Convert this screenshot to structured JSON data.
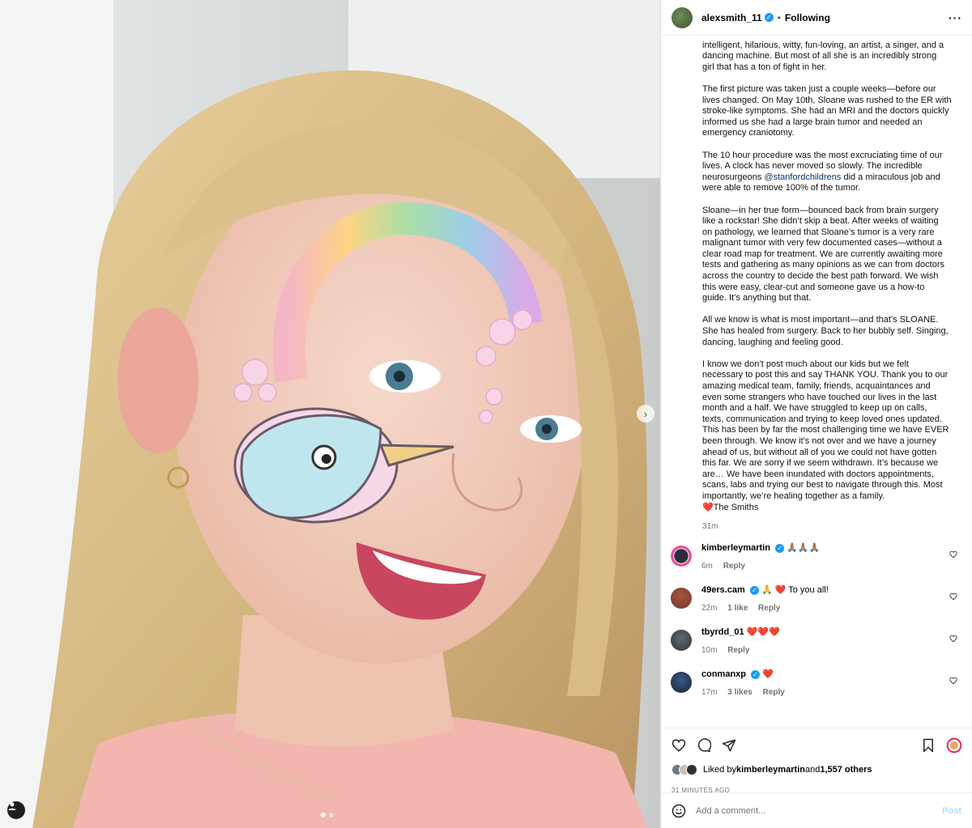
{
  "post": {
    "username": "alexsmith_11",
    "follow_status": "Following",
    "more_icon": "more-horizontal-icon"
  },
  "caption": {
    "p0": "intelligent, hilarious, witty, fun-loving, an artist, a singer, and a\ndancing machine. But most of all she is an incredibly strong\ngirl that has a ton of fight in her.",
    "p1": "The first picture was taken just a couple weeks—before our\nlives changed. On May 10th, Sloane was rushed to the ER with\nstroke-like symptoms. She had an MRI and the doctors quickly\ninformed us she had a large brain tumor and needed an\nemergency craniotomy.",
    "p2_a": "The 10 hour procedure was the most excruciating time of our\nlives. A clock has never moved so slowly. The incredible\nneurosurgeons ",
    "p2_mention": "@stanfordchildrens",
    "p2_b": " did a miraculous job and\nwere able to remove 100% of the tumor.",
    "p3": "Sloane—in her true form—bounced back from brain surgery\nlike a rockstar! She didn’t skip a beat. After weeks of waiting\non pathology, we learned that Sloane’s tumor is a very rare\nmalignant tumor with very few documented cases—without a\nclear road map for treatment. We are currently awaiting more\ntests and gathering as many opinions as we can from doctors\nacross the country to decide the best path forward. We wish\nthis were easy, clear-cut and someone gave us a how-to\nguide. It’s anything but that.",
    "p4": "All we know is what is most important—and that’s SLOANE.\nShe has healed from surgery. Back to her bubbly self. Singing,\ndancing, laughing and feeling good.",
    "p5": "I know we don’t post much about our kids but we felt\nnecessary to post this and say THANK YOU. Thank you to our\namazing medical team, family, friends, acquaintances and\neven some strangers who have touched our lives in the last\nmonth and a half. We have struggled to keep up on calls,\ntexts, communication and trying to keep loved ones updated.\nThis has been by far the most challenging time we have EVER\nbeen through. We know it’s not over and we have a journey\nahead of us, but without all of you we could not have gotten\nthis far. We are sorry if we seem withdrawn. It’s because we\nare… We have been inundated with doctors appointments,\nscans, labs and trying our best to navigate through this. Most\nimportantly, we’re healing together as a family.\n❤️The Smiths",
    "time": "31m"
  },
  "comments": [
    {
      "user": "kimberleymartin",
      "verified": true,
      "text": "🙏🏽🙏🏽🙏🏽",
      "time": "6m",
      "likes": "",
      "reply": "Reply"
    },
    {
      "user": "49ers.cam",
      "verified": true,
      "text": "🙏 ❤️ To you all!",
      "time": "22m",
      "likes": "1 like",
      "reply": "Reply"
    },
    {
      "user": "tbyrdd_01",
      "verified": false,
      "text": "❤️❤️❤️",
      "time": "10m",
      "likes": "",
      "reply": "Reply"
    },
    {
      "user": "conmanxp",
      "verified": true,
      "text": "❤️",
      "time": "17m",
      "likes": "3 likes",
      "reply": "Reply"
    }
  ],
  "actions": {
    "liked_by_prefix": "Liked by ",
    "liked_by_user": "kimberleymartin",
    "liked_by_mid": " and ",
    "liked_by_count": "1,557 others",
    "posted_ago": "31 MINUTES AGO",
    "comment_placeholder": "Add a comment...",
    "post_label": "Post"
  },
  "colors": {
    "link": "#00376b",
    "verified": "#1d9bf0",
    "muted": "#737373",
    "post_button": "#b2dffc"
  }
}
